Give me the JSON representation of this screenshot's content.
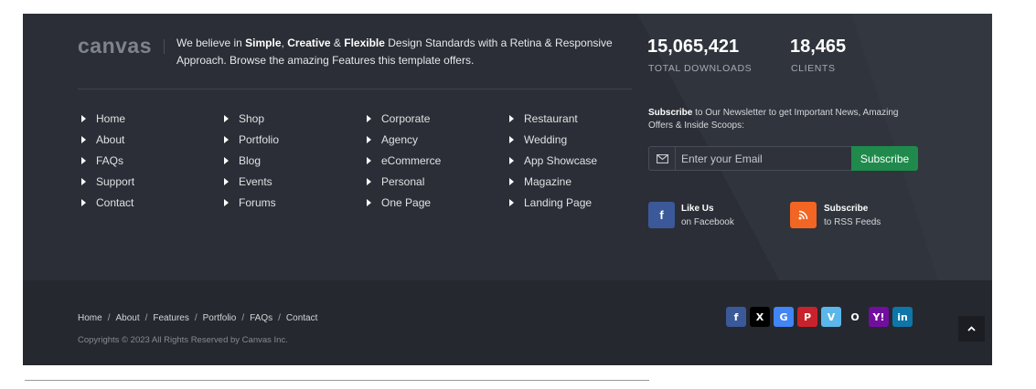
{
  "brand": {
    "logo_text": "canvas"
  },
  "intro": {
    "p1": "We believe in ",
    "b1": "Simple",
    "p2": ", ",
    "b2": "Creative",
    "p3": " & ",
    "b3": "Flexible",
    "p4": " Design Standards with a Retina & Responsive Approach. Browse the amazing Features this template offers."
  },
  "nav": {
    "col1": [
      "Home",
      "About",
      "FAQs",
      "Support",
      "Contact"
    ],
    "col2": [
      "Shop",
      "Portfolio",
      "Blog",
      "Events",
      "Forums"
    ],
    "col3": [
      "Corporate",
      "Agency",
      "eCommerce",
      "Personal",
      "One Page"
    ],
    "col4": [
      "Restaurant",
      "Wedding",
      "App Showcase",
      "Magazine",
      "Landing Page"
    ]
  },
  "stats": {
    "downloads_value": "15,065,421",
    "downloads_label": "TOTAL DOWNLOADS",
    "clients_value": "18,465",
    "clients_label": "CLIENTS"
  },
  "newsletter": {
    "bold": "Subscribe",
    "text": " to Our Newsletter to get Important News, Amazing Offers & Inside Scoops:",
    "placeholder": "Enter your Email",
    "button": "Subscribe"
  },
  "social_cta": {
    "facebook_title": "Like Us",
    "facebook_sub": "on Facebook",
    "rss_title": "Subscribe",
    "rss_sub": "to RSS Feeds"
  },
  "bottom": {
    "links": [
      "Home",
      "About",
      "Features",
      "Portfolio",
      "FAQs",
      "Contact"
    ],
    "separator": "/",
    "copyright": "Copyrights © 2023 All Rights Reserved by Canvas Inc."
  },
  "social_icons": [
    {
      "name": "facebook-icon",
      "glyph": "f",
      "color": "#3b5998"
    },
    {
      "name": "x-icon",
      "glyph": "X",
      "color": "#000000"
    },
    {
      "name": "google-icon",
      "glyph": "G",
      "color": "#4285f4"
    },
    {
      "name": "pinterest-icon",
      "glyph": "P",
      "color": "#c8232c"
    },
    {
      "name": "vimeo-icon",
      "glyph": "V",
      "color": "#5bb6ea"
    },
    {
      "name": "github-icon",
      "glyph": "O",
      "color": "#25282e"
    },
    {
      "name": "yahoo-icon",
      "glyph": "Y!",
      "color": "#720e9e"
    },
    {
      "name": "linkedin-icon",
      "glyph": "in",
      "color": "#0e76a8"
    }
  ],
  "colors": {
    "footer_bg": "#2b2e36",
    "bottom_bg": "#25282e",
    "subscribe_green": "#1f8a4c",
    "facebook_blue": "#3b5998",
    "rss_orange": "#f26522"
  }
}
